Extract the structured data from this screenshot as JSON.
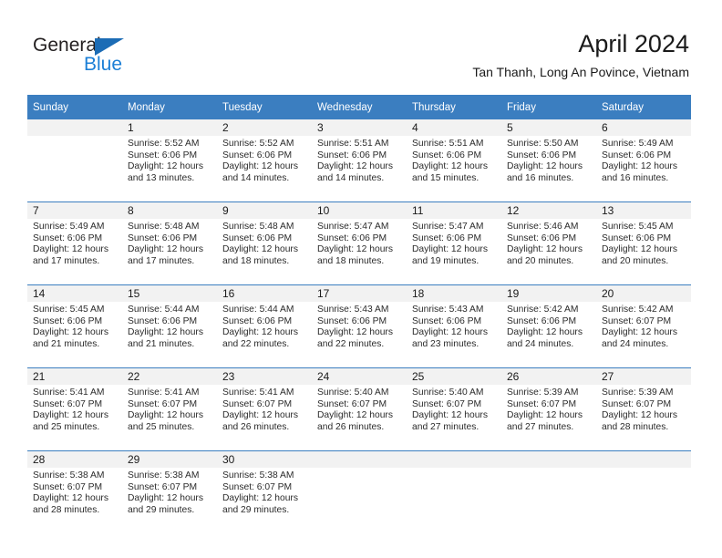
{
  "brand": {
    "name_primary": "General",
    "name_secondary": "Blue",
    "triangle_icon": "triangle-icon",
    "color_primary": "#231f20",
    "color_secondary": "#1c7fd6"
  },
  "header": {
    "title": "April 2024",
    "subtitle": "Tan Thanh, Long An Povince, Vietnam"
  },
  "theme": {
    "header_bg": "#3b7ec0",
    "header_text": "#ffffff",
    "daynum_bg": "#f2f2f2",
    "cell_bg": "#ffffff",
    "rule_color": "#3b7ec0"
  },
  "calendar": {
    "weekday_headers": [
      "Sunday",
      "Monday",
      "Tuesday",
      "Wednesday",
      "Thursday",
      "Friday",
      "Saturday"
    ],
    "weeks": [
      [
        {
          "day": "",
          "lines": []
        },
        {
          "day": "1",
          "lines": [
            "Sunrise: 5:52 AM",
            "Sunset: 6:06 PM",
            "Daylight: 12 hours",
            "and 13 minutes."
          ]
        },
        {
          "day": "2",
          "lines": [
            "Sunrise: 5:52 AM",
            "Sunset: 6:06 PM",
            "Daylight: 12 hours",
            "and 14 minutes."
          ]
        },
        {
          "day": "3",
          "lines": [
            "Sunrise: 5:51 AM",
            "Sunset: 6:06 PM",
            "Daylight: 12 hours",
            "and 14 minutes."
          ]
        },
        {
          "day": "4",
          "lines": [
            "Sunrise: 5:51 AM",
            "Sunset: 6:06 PM",
            "Daylight: 12 hours",
            "and 15 minutes."
          ]
        },
        {
          "day": "5",
          "lines": [
            "Sunrise: 5:50 AM",
            "Sunset: 6:06 PM",
            "Daylight: 12 hours",
            "and 16 minutes."
          ]
        },
        {
          "day": "6",
          "lines": [
            "Sunrise: 5:49 AM",
            "Sunset: 6:06 PM",
            "Daylight: 12 hours",
            "and 16 minutes."
          ]
        }
      ],
      [
        {
          "day": "7",
          "lines": [
            "Sunrise: 5:49 AM",
            "Sunset: 6:06 PM",
            "Daylight: 12 hours",
            "and 17 minutes."
          ]
        },
        {
          "day": "8",
          "lines": [
            "Sunrise: 5:48 AM",
            "Sunset: 6:06 PM",
            "Daylight: 12 hours",
            "and 17 minutes."
          ]
        },
        {
          "day": "9",
          "lines": [
            "Sunrise: 5:48 AM",
            "Sunset: 6:06 PM",
            "Daylight: 12 hours",
            "and 18 minutes."
          ]
        },
        {
          "day": "10",
          "lines": [
            "Sunrise: 5:47 AM",
            "Sunset: 6:06 PM",
            "Daylight: 12 hours",
            "and 18 minutes."
          ]
        },
        {
          "day": "11",
          "lines": [
            "Sunrise: 5:47 AM",
            "Sunset: 6:06 PM",
            "Daylight: 12 hours",
            "and 19 minutes."
          ]
        },
        {
          "day": "12",
          "lines": [
            "Sunrise: 5:46 AM",
            "Sunset: 6:06 PM",
            "Daylight: 12 hours",
            "and 20 minutes."
          ]
        },
        {
          "day": "13",
          "lines": [
            "Sunrise: 5:45 AM",
            "Sunset: 6:06 PM",
            "Daylight: 12 hours",
            "and 20 minutes."
          ]
        }
      ],
      [
        {
          "day": "14",
          "lines": [
            "Sunrise: 5:45 AM",
            "Sunset: 6:06 PM",
            "Daylight: 12 hours",
            "and 21 minutes."
          ]
        },
        {
          "day": "15",
          "lines": [
            "Sunrise: 5:44 AM",
            "Sunset: 6:06 PM",
            "Daylight: 12 hours",
            "and 21 minutes."
          ]
        },
        {
          "day": "16",
          "lines": [
            "Sunrise: 5:44 AM",
            "Sunset: 6:06 PM",
            "Daylight: 12 hours",
            "and 22 minutes."
          ]
        },
        {
          "day": "17",
          "lines": [
            "Sunrise: 5:43 AM",
            "Sunset: 6:06 PM",
            "Daylight: 12 hours",
            "and 22 minutes."
          ]
        },
        {
          "day": "18",
          "lines": [
            "Sunrise: 5:43 AM",
            "Sunset: 6:06 PM",
            "Daylight: 12 hours",
            "and 23 minutes."
          ]
        },
        {
          "day": "19",
          "lines": [
            "Sunrise: 5:42 AM",
            "Sunset: 6:06 PM",
            "Daylight: 12 hours",
            "and 24 minutes."
          ]
        },
        {
          "day": "20",
          "lines": [
            "Sunrise: 5:42 AM",
            "Sunset: 6:07 PM",
            "Daylight: 12 hours",
            "and 24 minutes."
          ]
        }
      ],
      [
        {
          "day": "21",
          "lines": [
            "Sunrise: 5:41 AM",
            "Sunset: 6:07 PM",
            "Daylight: 12 hours",
            "and 25 minutes."
          ]
        },
        {
          "day": "22",
          "lines": [
            "Sunrise: 5:41 AM",
            "Sunset: 6:07 PM",
            "Daylight: 12 hours",
            "and 25 minutes."
          ]
        },
        {
          "day": "23",
          "lines": [
            "Sunrise: 5:41 AM",
            "Sunset: 6:07 PM",
            "Daylight: 12 hours",
            "and 26 minutes."
          ]
        },
        {
          "day": "24",
          "lines": [
            "Sunrise: 5:40 AM",
            "Sunset: 6:07 PM",
            "Daylight: 12 hours",
            "and 26 minutes."
          ]
        },
        {
          "day": "25",
          "lines": [
            "Sunrise: 5:40 AM",
            "Sunset: 6:07 PM",
            "Daylight: 12 hours",
            "and 27 minutes."
          ]
        },
        {
          "day": "26",
          "lines": [
            "Sunrise: 5:39 AM",
            "Sunset: 6:07 PM",
            "Daylight: 12 hours",
            "and 27 minutes."
          ]
        },
        {
          "day": "27",
          "lines": [
            "Sunrise: 5:39 AM",
            "Sunset: 6:07 PM",
            "Daylight: 12 hours",
            "and 28 minutes."
          ]
        }
      ],
      [
        {
          "day": "28",
          "lines": [
            "Sunrise: 5:38 AM",
            "Sunset: 6:07 PM",
            "Daylight: 12 hours",
            "and 28 minutes."
          ]
        },
        {
          "day": "29",
          "lines": [
            "Sunrise: 5:38 AM",
            "Sunset: 6:07 PM",
            "Daylight: 12 hours",
            "and 29 minutes."
          ]
        },
        {
          "day": "30",
          "lines": [
            "Sunrise: 5:38 AM",
            "Sunset: 6:07 PM",
            "Daylight: 12 hours",
            "and 29 minutes."
          ]
        },
        {
          "day": "",
          "lines": []
        },
        {
          "day": "",
          "lines": []
        },
        {
          "day": "",
          "lines": []
        },
        {
          "day": "",
          "lines": []
        }
      ]
    ]
  }
}
